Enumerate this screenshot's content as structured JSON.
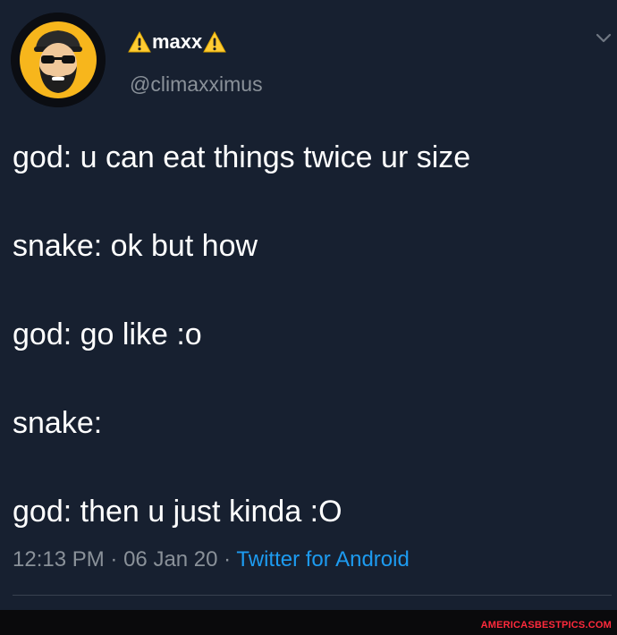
{
  "tweet": {
    "display_name": "maxx",
    "handle": "@climaxximus",
    "lines": [
      "god: u can eat things twice ur size",
      "snake: ok but how",
      "god: go like :o",
      "snake:",
      "god: then u just kinda :O"
    ],
    "time": "12:13 PM",
    "separator": "·",
    "date": "06 Jan 20",
    "source": "Twitter for Android"
  },
  "icons": {
    "name_prefix": "warning-icon",
    "name_suffix": "warning-icon",
    "menu": "chevron-down-icon",
    "avatar": "avatar-cartoon-man-sunglasses"
  },
  "colors": {
    "background": "#172030",
    "text": "#ffffff",
    "secondary_text": "#8a9199",
    "link": "#1d9bf0",
    "avatar_ring": "#f7b61c",
    "warning_yellow": "#ffcc33",
    "watermark": "#ff2a3c"
  },
  "watermark": "AMERICASBESTPICS.COM"
}
